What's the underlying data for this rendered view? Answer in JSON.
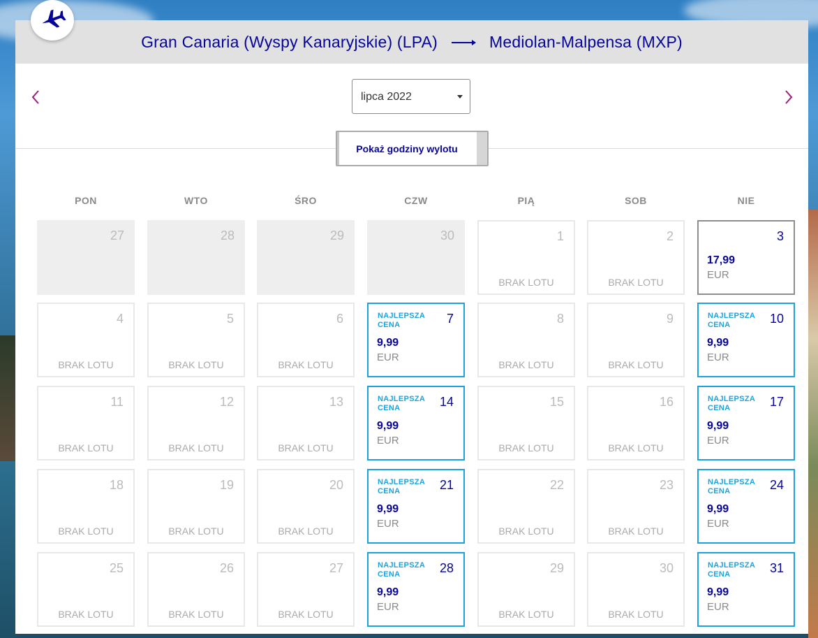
{
  "header": {
    "origin": "Gran Canaria (Wyspy Kanaryjskie) (LPA)",
    "destination": "Mediolan-Malpensa (MXP)"
  },
  "month_selector": {
    "value": "lipca 2022"
  },
  "toggle_button": {
    "label": "Pokaż godziny wylotu"
  },
  "weekdays": [
    "PON",
    "WTO",
    "ŚRO",
    "CZW",
    "PIĄ",
    "SOB",
    "NIE"
  ],
  "labels": {
    "no_flight": "BRAK LOTU",
    "best_price": "NAJLEPSZA CENA",
    "currency": "EUR"
  },
  "calendar": [
    [
      {
        "day": "27",
        "type": "empty"
      },
      {
        "day": "28",
        "type": "empty"
      },
      {
        "day": "29",
        "type": "empty"
      },
      {
        "day": "30",
        "type": "empty"
      },
      {
        "day": "1",
        "type": "noflight"
      },
      {
        "day": "2",
        "type": "noflight"
      },
      {
        "day": "3",
        "type": "priced",
        "price": "17,99"
      }
    ],
    [
      {
        "day": "4",
        "type": "noflight"
      },
      {
        "day": "5",
        "type": "noflight"
      },
      {
        "day": "6",
        "type": "noflight"
      },
      {
        "day": "7",
        "type": "best",
        "price": "9,99"
      },
      {
        "day": "8",
        "type": "noflight"
      },
      {
        "day": "9",
        "type": "noflight"
      },
      {
        "day": "10",
        "type": "best",
        "price": "9,99"
      }
    ],
    [
      {
        "day": "11",
        "type": "noflight"
      },
      {
        "day": "12",
        "type": "noflight"
      },
      {
        "day": "13",
        "type": "noflight"
      },
      {
        "day": "14",
        "type": "best",
        "price": "9,99"
      },
      {
        "day": "15",
        "type": "noflight"
      },
      {
        "day": "16",
        "type": "noflight"
      },
      {
        "day": "17",
        "type": "best",
        "price": "9,99"
      }
    ],
    [
      {
        "day": "18",
        "type": "noflight"
      },
      {
        "day": "19",
        "type": "noflight"
      },
      {
        "day": "20",
        "type": "noflight"
      },
      {
        "day": "21",
        "type": "best",
        "price": "9,99"
      },
      {
        "day": "22",
        "type": "noflight"
      },
      {
        "day": "23",
        "type": "noflight"
      },
      {
        "day": "24",
        "type": "best",
        "price": "9,99"
      }
    ],
    [
      {
        "day": "25",
        "type": "noflight"
      },
      {
        "day": "26",
        "type": "noflight"
      },
      {
        "day": "27",
        "type": "noflight"
      },
      {
        "day": "28",
        "type": "best",
        "price": "9,99"
      },
      {
        "day": "29",
        "type": "noflight"
      },
      {
        "day": "30",
        "type": "noflight"
      },
      {
        "day": "31",
        "type": "best",
        "price": "9,99"
      }
    ]
  ],
  "colors": {
    "brand_navy": "#06049b",
    "best_price_blue": "#1ba3df",
    "prev_arrow": "#9b1d7a",
    "next_arrow": "#9b1d7a"
  },
  "icons": {
    "badge": "airplane-icon",
    "prev": "chevron-left-icon",
    "next": "chevron-right-icon"
  }
}
